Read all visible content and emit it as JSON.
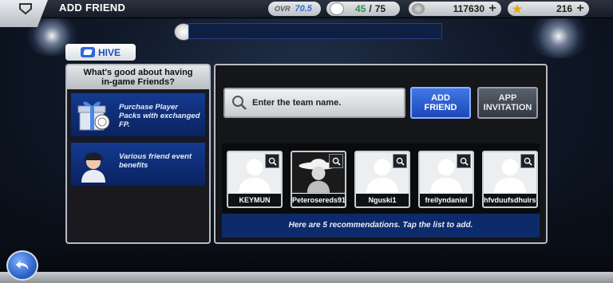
{
  "header": {
    "title": "ADD FRIEND",
    "ovr_label": "OVR",
    "ovr_value": "70.5",
    "friends_current": "45",
    "friends_separator": "/",
    "friends_max": "75",
    "fp_amount": "117630",
    "gold_amount": "216",
    "plus_symbol": "+"
  },
  "hive_tab": {
    "label": "HIVE"
  },
  "info_panel": {
    "title_line1": "What's good about having",
    "title_line2": "in-game Friends?",
    "benefits": [
      {
        "text": "Purchase Player Packs with exchanged FP.",
        "icon": "gift-box-icon"
      },
      {
        "text": "Various friend event benefits",
        "icon": "player-portrait-icon"
      }
    ]
  },
  "search": {
    "placeholder": "Enter the team name.",
    "add_friend_line1": "ADD",
    "add_friend_line2": "FRIEND",
    "app_invitation_line1": "APP",
    "app_invitation_line2": "INVITATION"
  },
  "recommendations": {
    "items": [
      {
        "name": "KEYMUN",
        "avatar": "default-silhouette"
      },
      {
        "name": "Peterosereds91",
        "avatar": "cowboy-hat"
      },
      {
        "name": "Nguski1",
        "avatar": "default-silhouette"
      },
      {
        "name": "freilyndaniel",
        "avatar": "default-silhouette"
      },
      {
        "name": "hfvduufsdhuirsf",
        "avatar": "default-silhouette"
      }
    ],
    "note": "Here are 5 recommendations. Tap the list to add."
  },
  "colors": {
    "accent_blue": "#1c48b8",
    "panel_border": "#b8bcc2",
    "note_bar": "#0d2a6b"
  }
}
